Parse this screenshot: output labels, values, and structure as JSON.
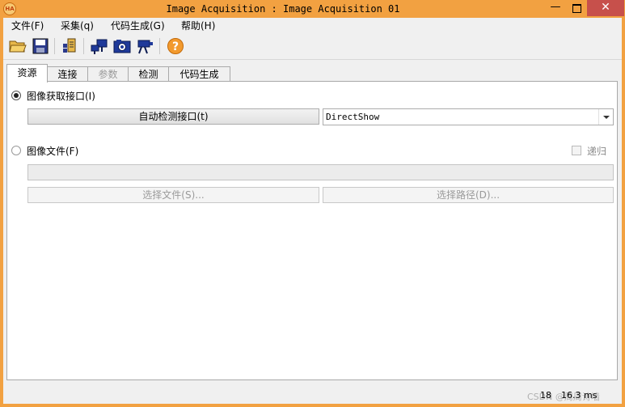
{
  "window": {
    "title": "Image Acquisition : Image Acquisition 01",
    "app_icon_label": "HA",
    "minimize": "—",
    "close": "✕"
  },
  "menu": {
    "items": [
      {
        "label": "文件(F)"
      },
      {
        "label": "采集(q)"
      },
      {
        "label": "代码生成(G)"
      },
      {
        "label": "帮助(H)"
      }
    ]
  },
  "toolbar": {
    "icons": [
      "open-folder-icon",
      "save-icon",
      "code-export-icon",
      "connect-icon",
      "camera-icon",
      "detect-icon",
      "help-icon"
    ],
    "help_glyph": "?"
  },
  "tabs": [
    {
      "label": "资源",
      "active": true,
      "enabled": true
    },
    {
      "label": "连接",
      "active": false,
      "enabled": true
    },
    {
      "label": "参数",
      "active": false,
      "enabled": false
    },
    {
      "label": "检测",
      "active": false,
      "enabled": true
    },
    {
      "label": "代码生成",
      "active": false,
      "enabled": true
    }
  ],
  "resources": {
    "interface_radio_label": "图像获取接口(I)",
    "interface_selected": true,
    "auto_detect_button": "自动检测接口(t)",
    "interface_value": "DirectShow",
    "file_radio_label": "图像文件(F)",
    "file_selected": false,
    "recursive_label": "递归",
    "recursive_checked": false,
    "file_path_value": "",
    "select_files_button": "选择文件(S)...",
    "select_path_button": "选择路径(D)..."
  },
  "status": {
    "frame_count": "18",
    "time": "16.3 ms",
    "watermark": "CSDN @周周诗墙"
  },
  "colors": {
    "frame": "#f2a141",
    "close_button": "#c7504b",
    "client_bg": "#f0f0f0"
  }
}
